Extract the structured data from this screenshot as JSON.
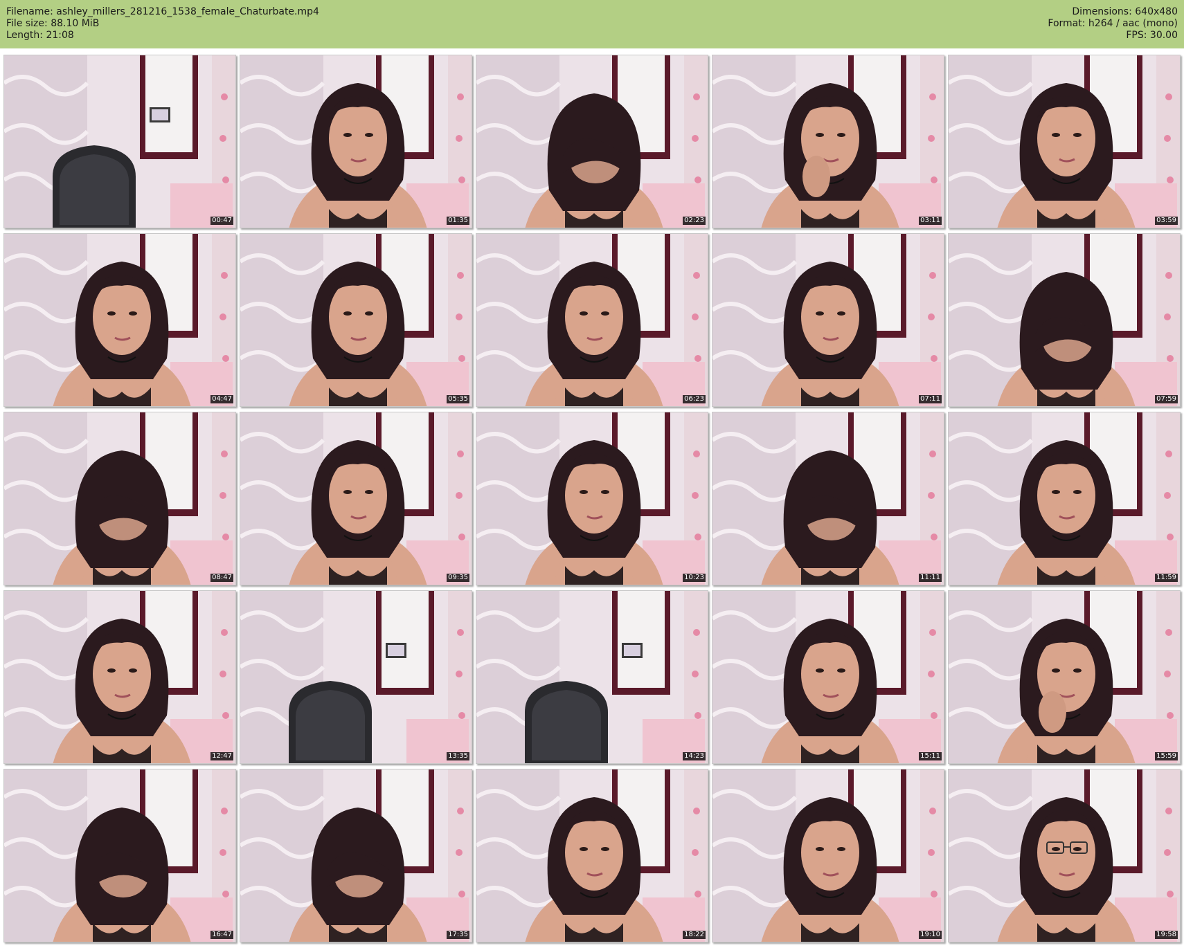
{
  "header": {
    "filename": "Filename: ashley_millers_281216_1538_female_Chaturbate.mp4",
    "filesize": "File size: 88.10 MiB",
    "length": "Length: 21:08",
    "dimensions": "Dimensions: 640x480",
    "format": "Format: h264 / aac (mono)",
    "fps": "FPS: 30.00"
  },
  "colors": {
    "header_bg": "#b3cf84",
    "wall": "#ece2e8",
    "hair": "#2b1a1e",
    "skin": "#d9a48c",
    "bra": "#1c1416",
    "mirror_frame": "#5a1a2a",
    "chair": "#2a2a2e",
    "jeans": "#9fb4c8"
  },
  "frames": [
    {
      "time": "00:47",
      "scene": "empty-chair"
    },
    {
      "time": "01:35",
      "scene": "person"
    },
    {
      "time": "02:23",
      "scene": "person-head-down"
    },
    {
      "time": "03:11",
      "scene": "person-hand"
    },
    {
      "time": "03:59",
      "scene": "person"
    },
    {
      "time": "04:47",
      "scene": "person"
    },
    {
      "time": "05:35",
      "scene": "person"
    },
    {
      "time": "06:23",
      "scene": "person"
    },
    {
      "time": "07:11",
      "scene": "person"
    },
    {
      "time": "07:59",
      "scene": "person-head-down"
    },
    {
      "time": "08:47",
      "scene": "person-head-down"
    },
    {
      "time": "09:35",
      "scene": "person"
    },
    {
      "time": "10:23",
      "scene": "person"
    },
    {
      "time": "11:11",
      "scene": "person-head-down"
    },
    {
      "time": "11:59",
      "scene": "person"
    },
    {
      "time": "12:47",
      "scene": "person"
    },
    {
      "time": "13:35",
      "scene": "empty-chair"
    },
    {
      "time": "14:23",
      "scene": "empty-chair"
    },
    {
      "time": "15:11",
      "scene": "person"
    },
    {
      "time": "15:59",
      "scene": "person-hand"
    },
    {
      "time": "16:47",
      "scene": "person-head-down"
    },
    {
      "time": "17:35",
      "scene": "person-head-down"
    },
    {
      "time": "18:22",
      "scene": "person"
    },
    {
      "time": "19:10",
      "scene": "person"
    },
    {
      "time": "19:58",
      "scene": "person-glasses"
    }
  ]
}
